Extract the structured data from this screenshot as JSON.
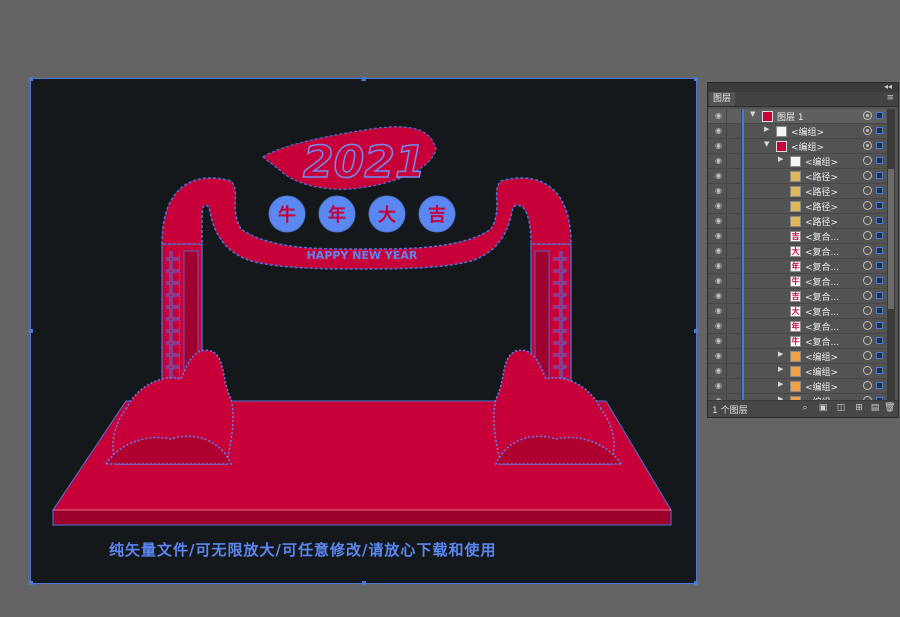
{
  "colors": {
    "workspace": "#646464",
    "artboard": "#15181b",
    "red": "#c8003a",
    "blue_outline": "#4a78d8",
    "panel": "#535353"
  },
  "artwork": {
    "year": "2021",
    "medallions": [
      "牛",
      "年",
      "大",
      "吉"
    ],
    "banner": "HAPPY NEW YEAR",
    "caption": "纯矢量文件/可无限放大/可任意修改/请放心下载和使用"
  },
  "layers_panel": {
    "tab": "图层",
    "rows": [
      {
        "label": "图层 1",
        "indent": 0,
        "arrow": "▼",
        "thumb": "layer",
        "thumb_text": "",
        "selected_target": true
      },
      {
        "label": "<编组>",
        "indent": 1,
        "arrow": "▶",
        "thumb": "white",
        "thumb_text": "",
        "selected_target": true
      },
      {
        "label": "<编组>",
        "indent": 1,
        "arrow": "▼",
        "thumb": "layer",
        "thumb_text": "",
        "selected_target": true
      },
      {
        "label": "<编组>",
        "indent": 2,
        "arrow": "▶",
        "thumb": "white",
        "thumb_text": "",
        "selected_target": false
      },
      {
        "label": "<路径>",
        "indent": 2,
        "arrow": "",
        "thumb": "gold",
        "thumb_text": "",
        "selected_target": false
      },
      {
        "label": "<路径>",
        "indent": 2,
        "arrow": "",
        "thumb": "gold",
        "thumb_text": "",
        "selected_target": false
      },
      {
        "label": "<路径>",
        "indent": 2,
        "arrow": "",
        "thumb": "gold",
        "thumb_text": "",
        "selected_target": false
      },
      {
        "label": "<路径>",
        "indent": 2,
        "arrow": "",
        "thumb": "gold",
        "thumb_text": "",
        "selected_target": false
      },
      {
        "label": "<复合...",
        "indent": 2,
        "arrow": "",
        "thumb": "char",
        "thumb_text": "吉",
        "selected_target": false
      },
      {
        "label": "<复合...",
        "indent": 2,
        "arrow": "",
        "thumb": "char",
        "thumb_text": "大",
        "selected_target": false
      },
      {
        "label": "<复合...",
        "indent": 2,
        "arrow": "",
        "thumb": "char",
        "thumb_text": "年",
        "selected_target": false
      },
      {
        "label": "<复合...",
        "indent": 2,
        "arrow": "",
        "thumb": "char",
        "thumb_text": "牛",
        "selected_target": false
      },
      {
        "label": "<复合...",
        "indent": 2,
        "arrow": "",
        "thumb": "char",
        "thumb_text": "吉",
        "selected_target": false
      },
      {
        "label": "<复合...",
        "indent": 2,
        "arrow": "",
        "thumb": "char",
        "thumb_text": "大",
        "selected_target": false
      },
      {
        "label": "<复合...",
        "indent": 2,
        "arrow": "",
        "thumb": "char",
        "thumb_text": "年",
        "selected_target": false
      },
      {
        "label": "<复合...",
        "indent": 2,
        "arrow": "",
        "thumb": "char",
        "thumb_text": "牛",
        "selected_target": false
      },
      {
        "label": "<编组>",
        "indent": 2,
        "arrow": "▶",
        "thumb": "orange",
        "thumb_text": "",
        "selected_target": false
      },
      {
        "label": "<编组>",
        "indent": 2,
        "arrow": "▶",
        "thumb": "orange",
        "thumb_text": "",
        "selected_target": false
      },
      {
        "label": "<编组>",
        "indent": 2,
        "arrow": "▶",
        "thumb": "orange",
        "thumb_text": "",
        "selected_target": false
      },
      {
        "label": "<编组>",
        "indent": 2,
        "arrow": "▶",
        "thumb": "orange",
        "thumb_text": "",
        "selected_target": false
      }
    ],
    "footer": {
      "count": "1 个图层",
      "icons": [
        "search-icon",
        "export-icon",
        "clip-mask-icon",
        "new-sublayer-icon",
        "new-layer-icon",
        "delete-icon"
      ]
    }
  }
}
